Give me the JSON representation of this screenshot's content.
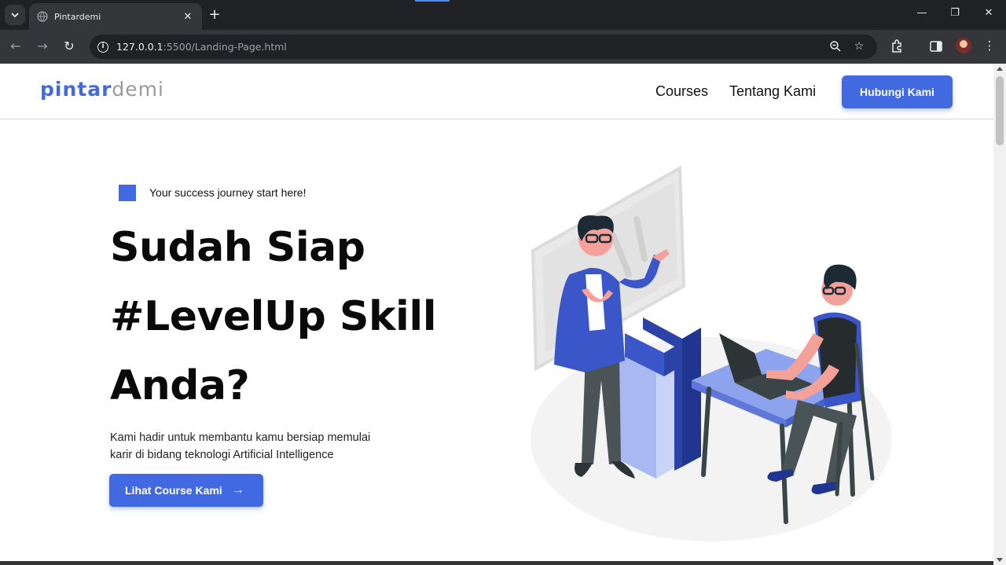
{
  "browser": {
    "tab_title": "Pintardemi",
    "tab_close": "✕",
    "new_tab": "+",
    "url_host": "127.0.0.1",
    "url_rest": ":5500/Landing-Page.html"
  },
  "site": {
    "logo_part1": "pintar",
    "logo_part2": "demi",
    "nav": {
      "courses": "Courses",
      "about": "Tentang Kami",
      "contact": "Hubungi Kami"
    }
  },
  "hero": {
    "tagline": "Your success journey start here!",
    "headline_line1": "Sudah Siap",
    "headline_line2": "#LevelUp Skill",
    "headline_line3": "Anda?",
    "description_line1": "Kami hadir untuk membantu kamu bersiap memulai",
    "description_line2": "karir di bidang teknologi Artificial Intelligence",
    "cta": "Lihat Course Kami",
    "cta_icon": "arrow-right-icon"
  },
  "colors": {
    "brand_blue": "#4169e1",
    "logo_gray": "#9a9a9a",
    "browser_dark": "#202124"
  }
}
